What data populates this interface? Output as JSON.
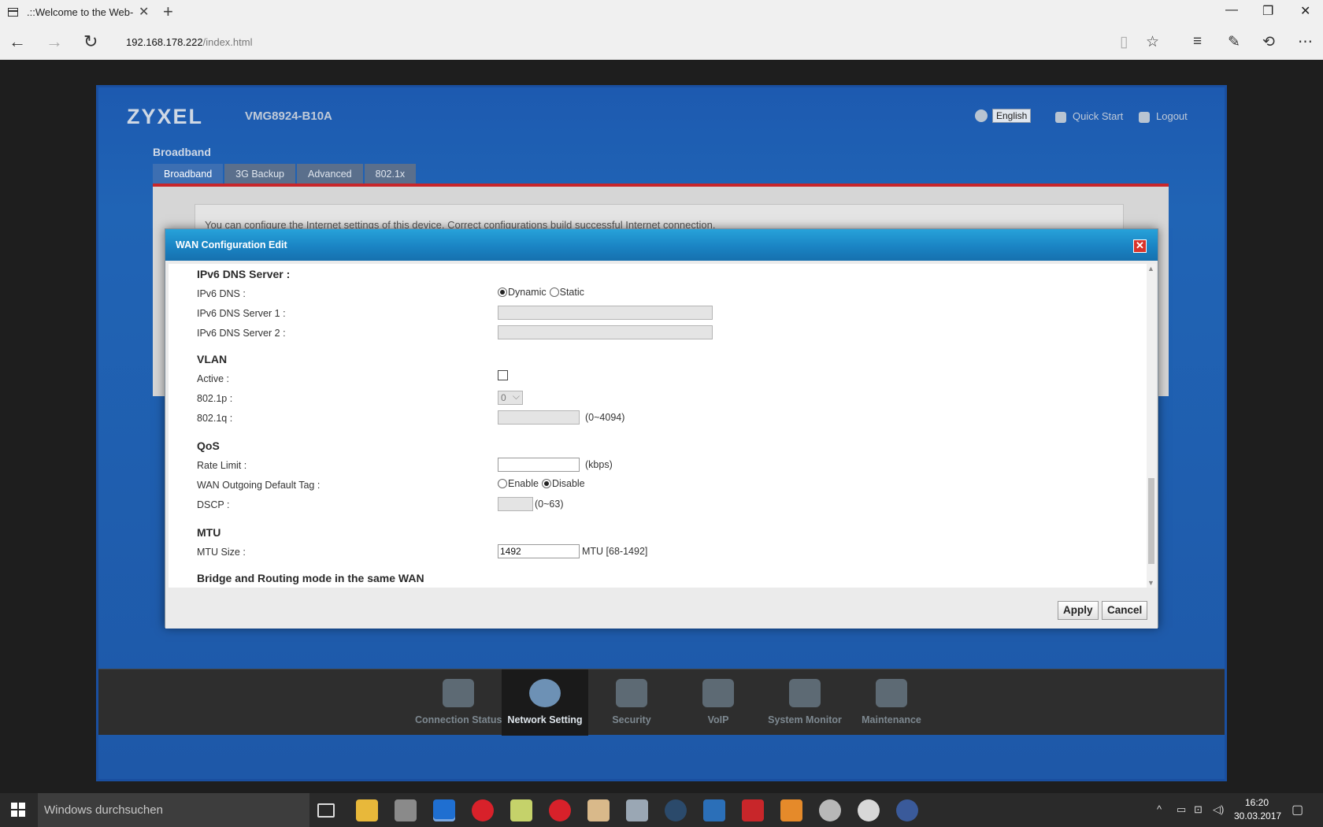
{
  "browser": {
    "tab_title": ".::Welcome to the Web-",
    "url_host": "192.168.178.222",
    "url_path": "/index.html"
  },
  "router": {
    "logo": "ZYXEL",
    "model": "VMG8924-B10A",
    "language": "English",
    "quick_start": "Quick Start",
    "logout": "Logout",
    "page_title": "Broadband",
    "tabs": [
      "Broadband",
      "3G Backup",
      "Advanced",
      "802.1x"
    ],
    "note": "You can configure the Internet settings of this device. Correct configurations build successful Internet connection.",
    "menu": [
      {
        "label": "Connection Status",
        "icon": "connection-status-icon"
      },
      {
        "label": "Network Setting",
        "icon": "gear-icon"
      },
      {
        "label": "Security",
        "icon": "shield-icon"
      },
      {
        "label": "VoIP",
        "icon": "phone-icon"
      },
      {
        "label": "System Monitor",
        "icon": "monitor-icon"
      },
      {
        "label": "Maintenance",
        "icon": "tools-icon"
      }
    ]
  },
  "modal": {
    "title": "WAN Configuration Edit",
    "ipv6dns": {
      "section": "IPv6 DNS Server :",
      "dns_label": "IPv6 DNS :",
      "dynamic": "Dynamic",
      "static": "Static",
      "server1_label": "IPv6 DNS Server 1 :",
      "server2_label": "IPv6 DNS Server 2 :"
    },
    "vlan": {
      "section": "VLAN",
      "active_label": "Active :",
      "p_label": "802.1p :",
      "p_value": "0",
      "q_label": "802.1q :",
      "q_hint": "(0~4094)"
    },
    "qos": {
      "section": "QoS",
      "rate_label": "Rate Limit :",
      "rate_unit": "(kbps)",
      "tag_label": "WAN Outgoing Default Tag :",
      "enable": "Enable",
      "disable": "Disable",
      "dscp_label": "DSCP :",
      "dscp_hint": "(0~63)"
    },
    "mtu": {
      "section": "MTU",
      "size_label": "MTU Size :",
      "size_value": "1492",
      "size_hint": "MTU [68-1492]"
    },
    "bridge_section": "Bridge and Routing mode in the same WAN",
    "apply": "Apply",
    "cancel": "Cancel"
  },
  "taskbar": {
    "search_placeholder": "Windows durchsuchen",
    "time": "16:20",
    "date": "30.03.2017"
  }
}
